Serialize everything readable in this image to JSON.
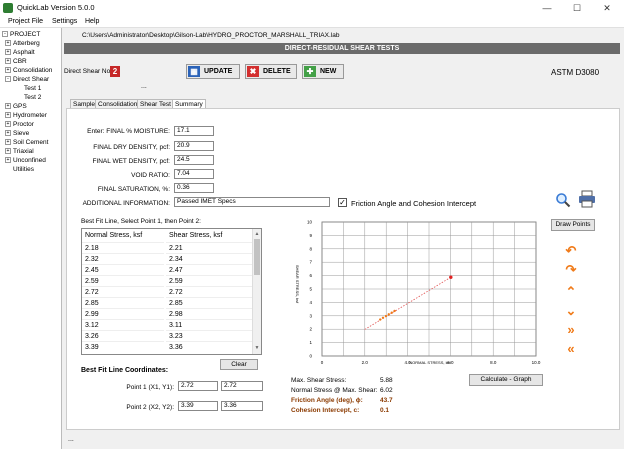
{
  "window": {
    "title": "QuickLab  Version 5.0.0"
  },
  "menu": {
    "items": [
      "Project File",
      "Settings",
      "Help"
    ]
  },
  "tree": {
    "root": "PROJECT",
    "items": [
      "Atterberg",
      "Asphalt",
      "CBR",
      "Consolidation",
      "Direct Shear",
      "Test 1",
      "Test 2",
      "GPS",
      "Hydrometer",
      "Proctor",
      "Sieve",
      "Soil Cement",
      "Triaxial",
      "Unconfined",
      "Utilities"
    ]
  },
  "path": "C:\\Users\\Administrator\\Desktop\\Gilson-Lab\\HYDRO_PROCTOR_MARSHALL_TRIAX.lab",
  "header": "DIRECT-RESIDUAL SHEAR TESTS",
  "toolbar": {
    "direct_shear_label": "Direct Shear No.",
    "direct_shear_no": "2",
    "update": "UPDATE",
    "delete": "DELETE",
    "new": "NEW",
    "standard": "ASTM D3080",
    "dots": "..."
  },
  "tabs": [
    "Sample",
    "Consolidation",
    "Shear Test",
    "Summary"
  ],
  "fields": [
    {
      "label": "Enter: FINAL % MOISTURE:",
      "value": "17.1"
    },
    {
      "label": "FINAL DRY DENSITY, pcf:",
      "value": "20.9"
    },
    {
      "label": "FINAL WET DENSITY, pcf:",
      "value": "24.5"
    },
    {
      "label": "VOID RATIO:",
      "value": "7.04"
    },
    {
      "label": "FINAL SATURATION, %:",
      "value": "0.36"
    }
  ],
  "additional": {
    "label": "ADDITIONAL INFORMATION:",
    "value": "Passed IMET Specs"
  },
  "checkbox": {
    "label": "Friction Angle and Cohesion Intercept",
    "checked": "✓"
  },
  "bestfit": {
    "instruction": "Best Fit Line, Select Point 1, then Point 2:",
    "headers": [
      "Normal Stress, ksf",
      "Shear Stress, ksf"
    ],
    "rows": [
      [
        "2.18",
        "2.21"
      ],
      [
        "2.32",
        "2.34"
      ],
      [
        "2.45",
        "2.47"
      ],
      [
        "2.59",
        "2.59"
      ],
      [
        "2.72",
        "2.72"
      ],
      [
        "2.85",
        "2.85"
      ],
      [
        "2.99",
        "2.98"
      ],
      [
        "3.12",
        "3.11"
      ],
      [
        "3.26",
        "3.23"
      ],
      [
        "3.39",
        "3.36"
      ]
    ],
    "clear": "Clear",
    "coords_title": "Best Fit Line Coordinates:",
    "p1_label": "Point 1 (X1, Y1):",
    "p1": [
      "2.72",
      "2.72"
    ],
    "p2_label": "Point 2 (X2, Y2):",
    "p2": [
      "3.39",
      "3.36"
    ]
  },
  "draw_points": "Draw Points",
  "calc_graph": "Calculate - Graph",
  "results": {
    "max_shear_label": "Max. Shear Stress:",
    "max_shear": "5.88",
    "normal_label": "Normal Stress @ Max. Shear:",
    "normal": "6.02",
    "friction_label": "Friction Angle (deg), ϕ:",
    "friction": "43.7",
    "cohesion_label": "Cohesion Intercept, c:",
    "cohesion": "0.1"
  },
  "footer": "...",
  "chart_data": {
    "type": "scatter",
    "xlabel": "NORMAL STRESS, ksf",
    "ylabel": "SHEAR STRESS, ksf",
    "xlim": [
      0,
      10
    ],
    "ylim": [
      0,
      10
    ],
    "xticks": [
      "0",
      "2.0",
      "4.0",
      "6.0",
      "8.0",
      "10.0"
    ],
    "yticks": [
      "0",
      "1",
      "2",
      "3",
      "4",
      "5",
      "6",
      "7",
      "8",
      "9",
      "10"
    ],
    "grid": true,
    "series": [
      {
        "x": [
          2.72,
          2.85,
          2.99,
          3.12,
          3.26,
          3.39
        ],
        "y": [
          2.72,
          2.85,
          2.98,
          3.11,
          3.23,
          3.36
        ],
        "color": "#f07b1a"
      },
      {
        "x": [
          6.02
        ],
        "y": [
          5.88
        ],
        "color": "#e02020"
      }
    ],
    "fit_line": {
      "x": [
        2.0,
        6.02
      ],
      "y": [
        1.98,
        5.88
      ],
      "color": "#e05050"
    }
  }
}
